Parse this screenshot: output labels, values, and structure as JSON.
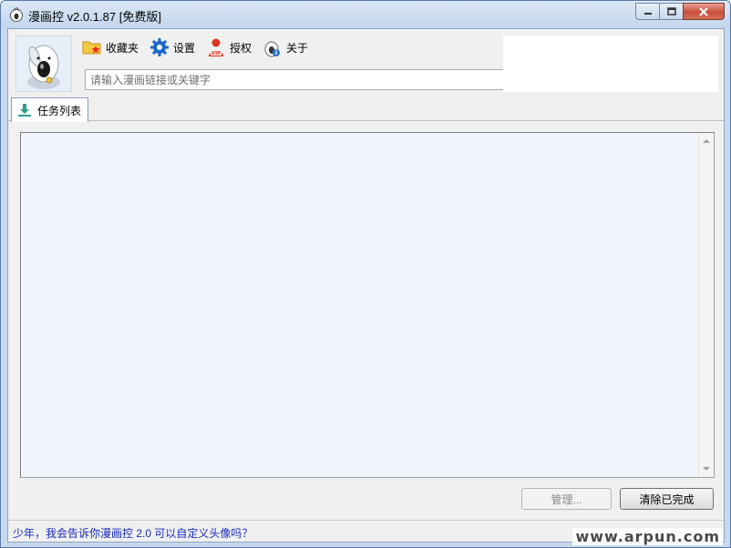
{
  "window": {
    "title": "漫画控 v2.0.1.87 [免费版]",
    "controls": {
      "minimize": "minimize",
      "maximize": "maximize",
      "close": "close"
    }
  },
  "toolbar": {
    "items": [
      {
        "label": "收藏夹",
        "icon": "favorites-folder-icon"
      },
      {
        "label": "设置",
        "icon": "gear-icon"
      },
      {
        "label": "授权",
        "icon": "vip-user-icon"
      },
      {
        "label": "关于",
        "icon": "info-icon"
      }
    ]
  },
  "search": {
    "value": "",
    "placeholder": "请输入漫画链接或关键字"
  },
  "tabs": [
    {
      "label": "任务列表",
      "icon": "download-icon",
      "active": true
    }
  ],
  "tasklist": {
    "rows": []
  },
  "actions": {
    "manage_label": "管理...",
    "clear_label": "清除已完成"
  },
  "statusbar": {
    "text": "少年，我会告诉你漫画控 2.0 可以自定义头像吗？"
  },
  "watermark": "www.arpun.com",
  "colors": {
    "status_text": "#1a2bb8",
    "list_bg": "#eff5fb",
    "titlebar": "#c7d9ed"
  }
}
